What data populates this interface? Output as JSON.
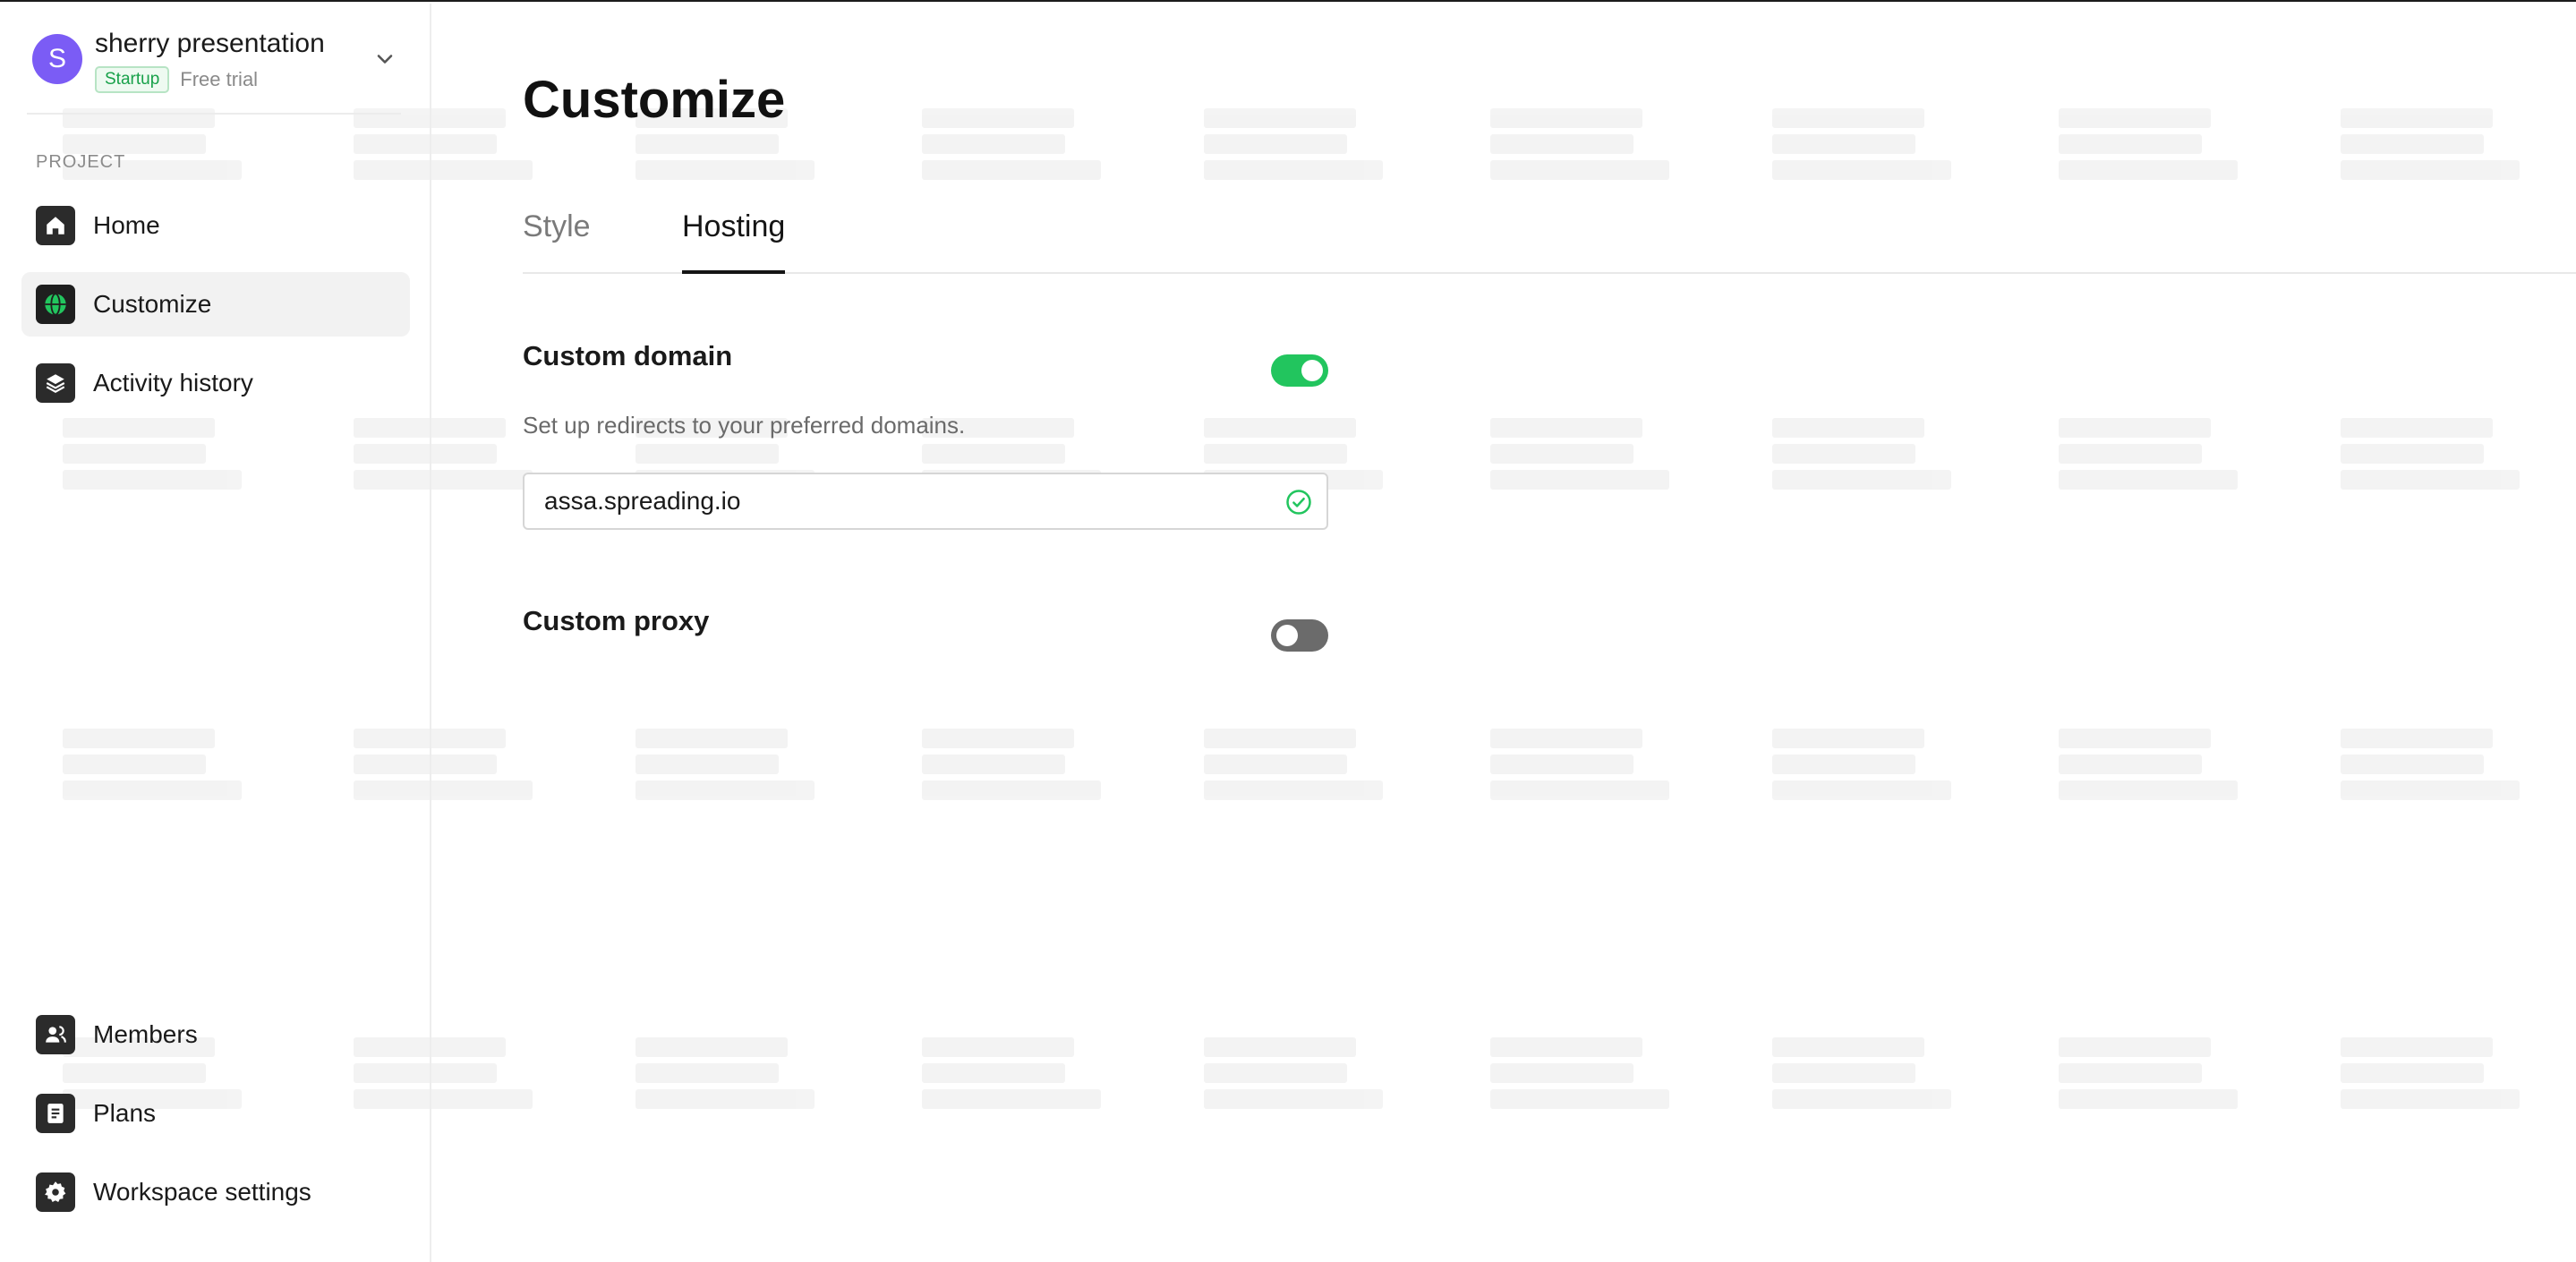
{
  "workspace": {
    "name": "sherry presentation",
    "avatar_letter": "S",
    "plan_badge": "Startup",
    "trial_label": "Free trial"
  },
  "sidebar": {
    "section_label": "PROJECT",
    "items": [
      {
        "label": "Home",
        "icon": "home-icon"
      },
      {
        "label": "Customize",
        "icon": "globe-icon",
        "active": true
      },
      {
        "label": "Activity history",
        "icon": "layers-icon"
      }
    ],
    "bottom_items": [
      {
        "label": "Members",
        "icon": "members-icon"
      },
      {
        "label": "Plans",
        "icon": "document-icon"
      },
      {
        "label": "Workspace settings",
        "icon": "gear-icon"
      }
    ]
  },
  "page": {
    "title": "Customize",
    "tabs": [
      {
        "label": "Style",
        "active": false
      },
      {
        "label": "Hosting",
        "active": true
      }
    ]
  },
  "hosting": {
    "custom_domain": {
      "title": "Custom domain",
      "description": "Set up redirects to your preferred domains.",
      "enabled": true,
      "value": "assa.spreading.io",
      "status_icon": "check-circle-icon"
    },
    "custom_proxy": {
      "title": "Custom proxy",
      "enabled": false
    }
  },
  "colors": {
    "accent_purple": "#7b5cf5",
    "toggle_on": "#22c55e",
    "toggle_off": "#6b6b6b",
    "startup_badge": "#18a14a"
  }
}
